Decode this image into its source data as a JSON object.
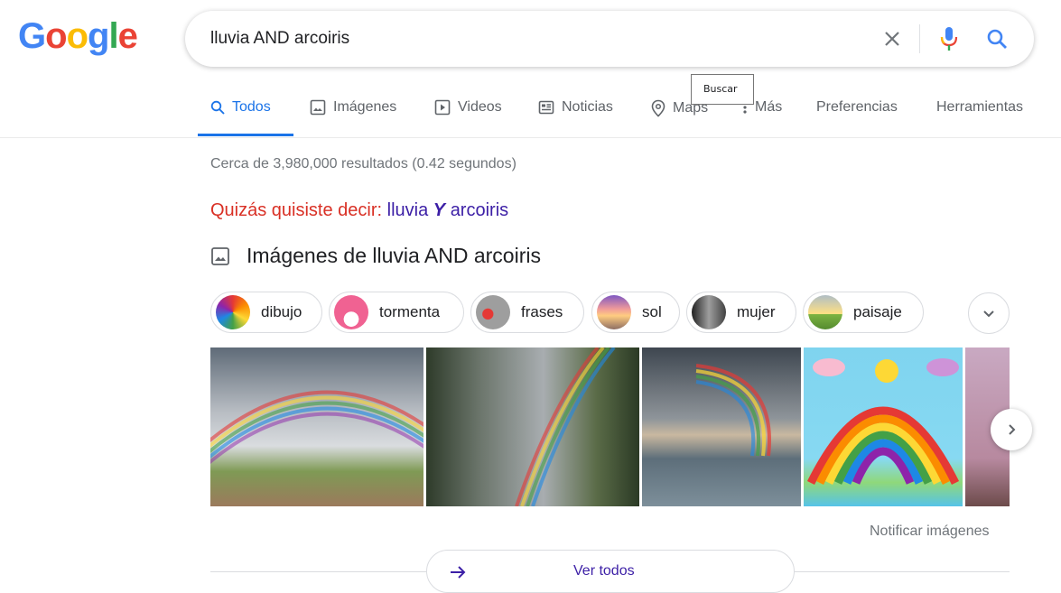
{
  "logo": {
    "letters": [
      "G",
      "o",
      "o",
      "g",
      "l",
      "e"
    ],
    "colors": [
      "#4285f4",
      "#ea4335",
      "#fbbc05",
      "#4285f4",
      "#34a853",
      "#ea4335"
    ]
  },
  "search": {
    "query": "lluvia AND arcoiris",
    "tooltip": "Buscar"
  },
  "tabs": [
    {
      "label": "Todos",
      "icon": "search-icon"
    },
    {
      "label": "Imágenes",
      "icon": "image-icon"
    },
    {
      "label": "Videos",
      "icon": "play-icon"
    },
    {
      "label": "Noticias",
      "icon": "news-icon"
    },
    {
      "label": "Maps",
      "icon": "pin-icon"
    },
    {
      "label": "Más",
      "icon": "more-vert-icon"
    },
    {
      "label": "Preferencias"
    },
    {
      "label": "Herramientas"
    }
  ],
  "results": {
    "stats": "Cerca de 3,980,000 resultados (0.42 segundos)"
  },
  "did_you_mean": {
    "prefix": "Quizás quisiste decir:",
    "part1": "lluvia",
    "emph": "Y",
    "part2": "arcoiris"
  },
  "images": {
    "heading": "Imágenes de lluvia AND arcoiris",
    "chips": [
      "dibujo",
      "tormenta",
      "frases",
      "sol",
      "mujer",
      "paisaje"
    ],
    "report": "Notificar imágenes",
    "view_all": "Ver todos"
  },
  "colors": {
    "accent": "#1a73e8",
    "visited_link": "#3c1fa6",
    "suggestion": "#d93025",
    "muted": "#70757a"
  }
}
